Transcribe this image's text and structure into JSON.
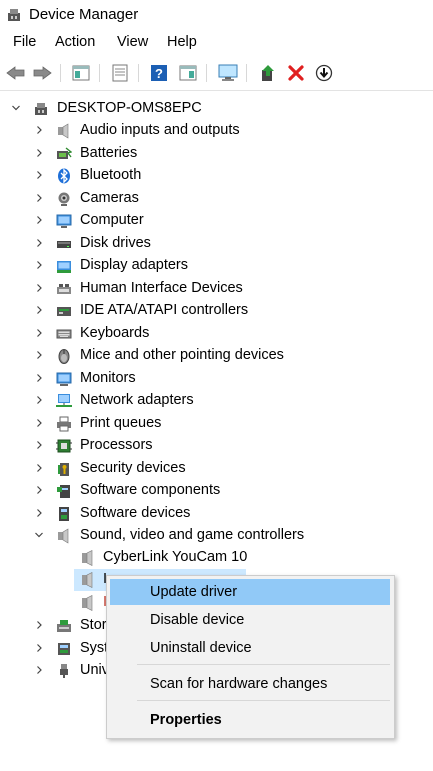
{
  "window": {
    "title": "Device Manager"
  },
  "menu": [
    "File",
    "Action",
    "View",
    "Help"
  ],
  "toolbar": {
    "buttons": [
      "back-icon",
      "forward-icon",
      "show-hide-console-tree-icon",
      "properties-icon",
      "help-icon",
      "action-pane-icon",
      "scan-for-hardware-changes-icon",
      "update-driver-icon",
      "uninstall-device-icon",
      "disable-device-icon"
    ],
    "colors": {
      "help": "#1c5fb4",
      "uninstall": "#e02020",
      "update": "#2e9b3c"
    }
  },
  "tree": {
    "root": "DESKTOP-OMS8EPC",
    "categories": [
      {
        "label": "Audio inputs and outputs",
        "icon": "speaker-icon"
      },
      {
        "label": "Batteries",
        "icon": "battery-icon"
      },
      {
        "label": "Bluetooth",
        "icon": "bluetooth-icon"
      },
      {
        "label": "Cameras",
        "icon": "camera-icon"
      },
      {
        "label": "Computer",
        "icon": "computer-icon"
      },
      {
        "label": "Disk drives",
        "icon": "disk-drive-icon"
      },
      {
        "label": "Display adapters",
        "icon": "display-adapter-icon"
      },
      {
        "label": "Human Interface Devices",
        "icon": "hid-icon"
      },
      {
        "label": "IDE ATA/ATAPI controllers",
        "icon": "ide-controller-icon"
      },
      {
        "label": "Keyboards",
        "icon": "keyboard-icon"
      },
      {
        "label": "Mice and other pointing devices",
        "icon": "mouse-icon"
      },
      {
        "label": "Monitors",
        "icon": "monitor-icon"
      },
      {
        "label": "Network adapters",
        "icon": "network-adapter-icon"
      },
      {
        "label": "Print queues",
        "icon": "printer-icon"
      },
      {
        "label": "Processors",
        "icon": "processor-icon"
      },
      {
        "label": "Security devices",
        "icon": "security-device-icon"
      },
      {
        "label": "Software components",
        "icon": "software-component-icon"
      },
      {
        "label": "Software devices",
        "icon": "software-device-icon"
      },
      {
        "label": "Sound, video and game controllers",
        "icon": "speaker-icon",
        "expanded": true
      }
    ],
    "sound_children": [
      "CyberLink YouCam 10",
      "I",
      "I"
    ],
    "after_categories": [
      {
        "label": "Stor",
        "icon": "storage-controller-icon"
      },
      {
        "label": "Syst",
        "icon": "system-device-icon"
      },
      {
        "label": "Univ",
        "icon": "usb-icon"
      }
    ]
  },
  "context_menu": {
    "items": [
      "Update driver",
      "Disable device",
      "Uninstall device"
    ],
    "scan": "Scan for hardware changes",
    "properties": "Properties",
    "highlighted": "Update driver"
  }
}
